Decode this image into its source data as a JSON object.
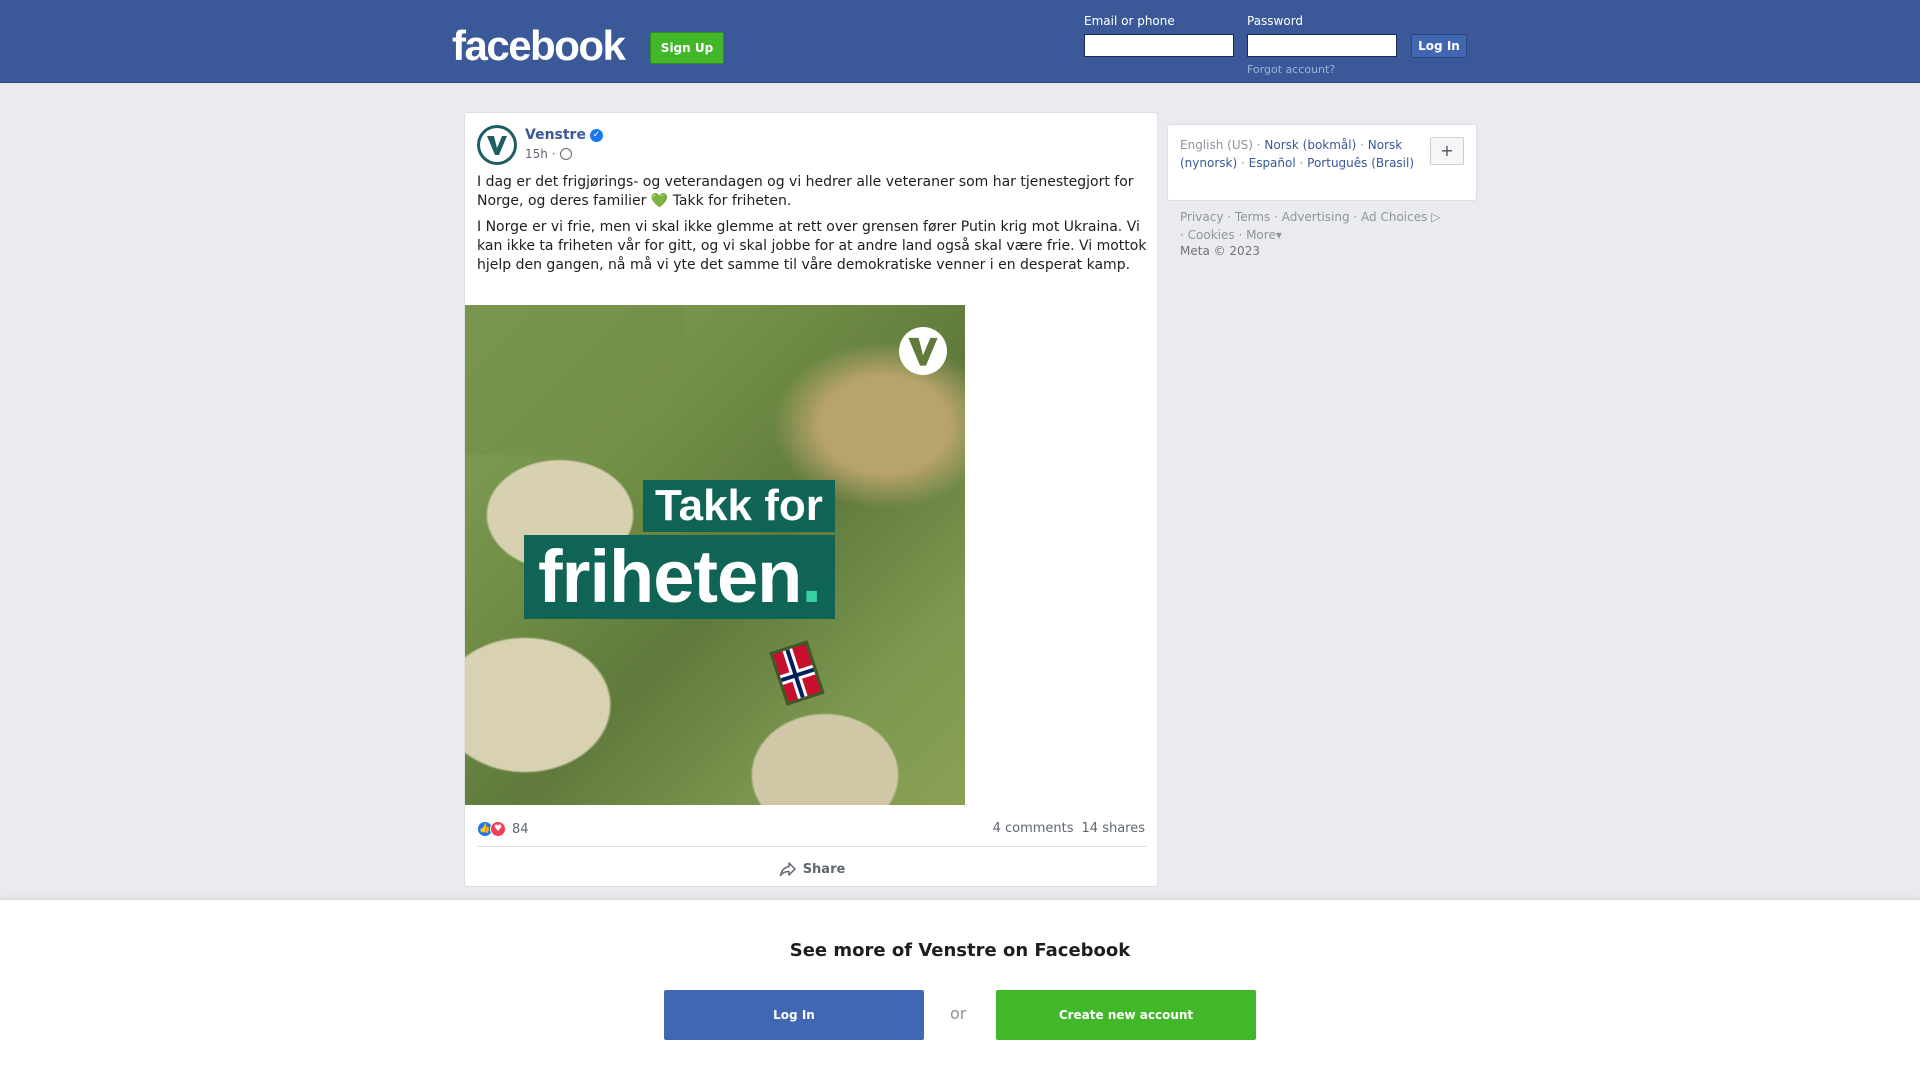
{
  "header": {
    "logo": "facebook",
    "signup_label": "Sign Up",
    "email_label": "Email or phone",
    "password_label": "Password",
    "login_label": "Log In",
    "forgot_label": "Forgot account?"
  },
  "post": {
    "author": "Venstre",
    "time": "15h ·",
    "paragraph1_a": "I dag er det frigjørings- og veterandagen og vi hedrer alle veteraner som har tjenestegjort for Norge, og deres familier",
    "paragraph1_emoji": "💚",
    "paragraph1_b": "Takk for friheten.",
    "paragraph2": "I Norge er vi frie, men vi skal ikke glemme at rett over grensen fører Putin krig mot Ukraina. Vi kan ikke ta friheten vår for gitt, og vi skal jobbe for at andre land også skal være frie. Vi mottok hjelp den gangen, nå må vi yte det samme til våre demokratiske venner i en desperat kamp.",
    "image_text_line1": "Takk for",
    "image_text_line2": "friheten",
    "image_text_dot": ".",
    "reaction_count": "84",
    "comments": "4 comments",
    "shares": "14 shares",
    "share_label": "Share"
  },
  "sidebar": {
    "languages": [
      {
        "label": "English (US)",
        "active": true
      },
      {
        "label": "Norsk (bokmål)"
      },
      {
        "label": "Norsk (nynorsk)"
      },
      {
        "label": "Español"
      },
      {
        "label": "Português (Brasil)"
      }
    ],
    "plus_label": "+",
    "footer_links": [
      "Privacy",
      "Terms",
      "Advertising",
      "Ad Choices",
      "Cookies",
      "More"
    ],
    "copyright": "Meta © 2023"
  },
  "bottom": {
    "title": "See more of Venstre on Facebook",
    "login_label": "Log In",
    "or_label": "or",
    "create_label": "Create new account"
  },
  "colors": {
    "brand_blue": "#3b5998",
    "green": "#42b72a",
    "venstre_green": "#0f6455"
  }
}
